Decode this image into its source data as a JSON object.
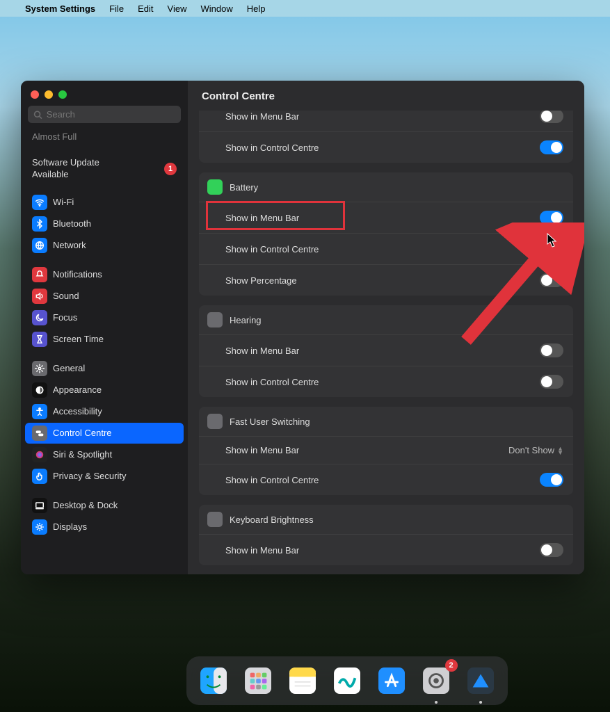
{
  "menubar": {
    "app_name": "System Settings",
    "items": [
      "File",
      "Edit",
      "View",
      "Window",
      "Help"
    ]
  },
  "window": {
    "title": "Control Centre"
  },
  "search": {
    "placeholder": "Search"
  },
  "sidebar": {
    "almost_full": "Almost Full",
    "software_update": "Software Update Available",
    "software_update_badge": "1",
    "groups": [
      [
        {
          "label": "Wi-Fi",
          "icon_bg": "#0a7cff",
          "icon": "wifi"
        },
        {
          "label": "Bluetooth",
          "icon_bg": "#0a7cff",
          "icon": "bt"
        },
        {
          "label": "Network",
          "icon_bg": "#0a7cff",
          "icon": "net"
        }
      ],
      [
        {
          "label": "Notifications",
          "icon_bg": "#e0383e",
          "icon": "bell"
        },
        {
          "label": "Sound",
          "icon_bg": "#e0383e",
          "icon": "sound"
        },
        {
          "label": "Focus",
          "icon_bg": "#5753cf",
          "icon": "moon"
        },
        {
          "label": "Screen Time",
          "icon_bg": "#5753cf",
          "icon": "hour"
        }
      ],
      [
        {
          "label": "General",
          "icon_bg": "#6a6a6e",
          "icon": "gear"
        },
        {
          "label": "Appearance",
          "icon_bg": "#111",
          "icon": "appear"
        },
        {
          "label": "Accessibility",
          "icon_bg": "#0a7cff",
          "icon": "acc"
        },
        {
          "label": "Control Centre",
          "icon_bg": "#6a6a6e",
          "icon": "cc",
          "selected": true
        },
        {
          "label": "Siri & Spotlight",
          "icon_bg": "#222",
          "icon": "siri"
        },
        {
          "label": "Privacy & Security",
          "icon_bg": "#0a7cff",
          "icon": "hand"
        }
      ],
      [
        {
          "label": "Desktop & Dock",
          "icon_bg": "#111",
          "icon": "desk"
        },
        {
          "label": "Displays",
          "icon_bg": "#0a7cff",
          "icon": "disp"
        }
      ]
    ]
  },
  "main": {
    "sections_partial": {
      "rows": [
        {
          "label": "Show in Menu Bar",
          "toggle": false
        },
        {
          "label": "Show in Control Centre",
          "toggle": true
        }
      ]
    },
    "sections": [
      {
        "title": "Battery",
        "icon_bg": "#32d159",
        "rows": [
          {
            "label": "Show in Menu Bar",
            "toggle": true,
            "highlight": true
          },
          {
            "label": "Show in Control Centre",
            "toggle": false
          },
          {
            "label": "Show Percentage",
            "toggle": false
          }
        ]
      },
      {
        "title": "Hearing",
        "icon_bg": "#6a6a6e",
        "rows": [
          {
            "label": "Show in Menu Bar",
            "toggle": false
          },
          {
            "label": "Show in Control Centre",
            "toggle": false
          }
        ]
      },
      {
        "title": "Fast User Switching",
        "icon_bg": "#6a6a6e",
        "rows": [
          {
            "label": "Show in Menu Bar",
            "dropdown": "Don't Show"
          },
          {
            "label": "Show in Control Centre",
            "toggle": true
          }
        ]
      },
      {
        "title": "Keyboard Brightness",
        "icon_bg": "#6a6a6e",
        "rows": [
          {
            "label": "Show in Menu Bar",
            "toggle": false
          }
        ]
      }
    ]
  },
  "dock": {
    "items": [
      {
        "name": "finder",
        "bg": "linear-gradient(#1fa5ff,#0a7cff)"
      },
      {
        "name": "launchpad",
        "bg": "#d8d8dc"
      },
      {
        "name": "notes",
        "bg": "linear-gradient(#ffd94a 40%,#fff 40%)"
      },
      {
        "name": "freeform",
        "bg": "#fff"
      },
      {
        "name": "appstore",
        "bg": "linear-gradient(#1fa5ff,#0a7cff)"
      },
      {
        "name": "settings",
        "bg": "#cfcfd2",
        "badge": "2",
        "running": true
      },
      {
        "name": "unknown",
        "bg": "#3a4a55",
        "running": true
      }
    ]
  }
}
